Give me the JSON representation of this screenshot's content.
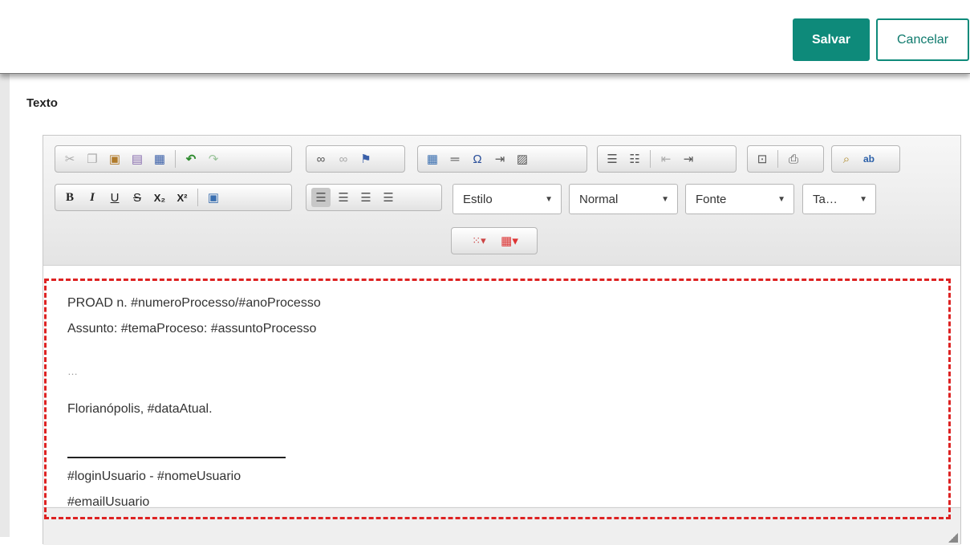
{
  "header": {
    "save_label": "Salvar",
    "cancel_label": "Cancelar"
  },
  "field": {
    "label": "Texto"
  },
  "toolbar": {
    "row1": [
      [
        "cut-icon",
        "copy-icon",
        "paste-icon",
        "paste-text-icon",
        "paste-word-icon",
        "undo-icon",
        "redo-icon"
      ],
      [
        "link-icon",
        "unlink-icon",
        "anchor-icon"
      ],
      [
        "table-icon",
        "horizontal-line-icon",
        "special-char-icon",
        "page-break-icon",
        "image-icon"
      ],
      [
        "numbered-list-icon",
        "bulleted-list-icon",
        "outdent-icon",
        "indent-icon"
      ],
      [
        "preview-icon",
        "print-icon"
      ],
      [
        "find-icon",
        "replace-icon"
      ]
    ],
    "row2": {
      "format_buttons": [
        "bold-icon",
        "italic-icon",
        "underline-icon",
        "strike-icon",
        "subscript-icon",
        "superscript-icon",
        "source-icon"
      ],
      "align_buttons": [
        "align-left-icon",
        "align-center-icon",
        "align-right-icon",
        "align-justify-icon"
      ],
      "combos": {
        "style": "Estilo",
        "format": "Normal",
        "font": "Fonte",
        "size": "Ta…"
      }
    },
    "row3": [
      "text-color-icon",
      "table-color-icon"
    ]
  },
  "content": {
    "lines": [
      "PROAD n. #numeroProcesso/#anoProcesso",
      "Assunto: #temaProceso: #assuntoProcesso",
      "…",
      "Florianópolis, #dataAtual.",
      "#loginUsuario - #nomeUsuario",
      "#emailUsuario"
    ]
  }
}
